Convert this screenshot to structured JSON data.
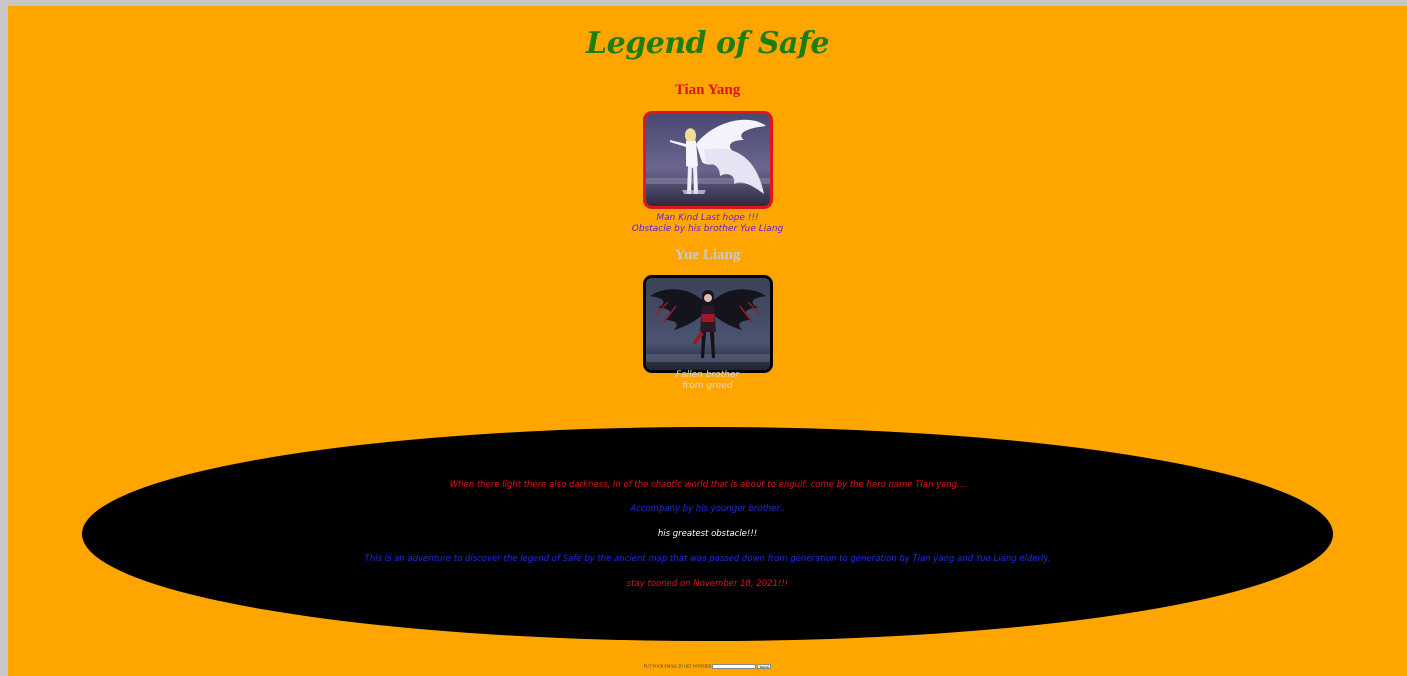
{
  "page": {
    "title": "Legend of Safe"
  },
  "heroes": [
    {
      "name": "Tian Yang",
      "name_color": "#e0141c",
      "frame_color": "#e0141c",
      "caption_lines": [
        "Man Kind Last hope !!!",
        "Obstacle by his brother Yue Liang"
      ],
      "caption_color": "#6a1fd0"
    },
    {
      "name": "Yue Liang",
      "name_color": "#c9c9c9",
      "frame_color": "#000000",
      "caption_lines": [
        "Fallen brother",
        "from greed"
      ],
      "caption_color": "#d8d8d8"
    }
  ],
  "story": {
    "lines": [
      {
        "text": "When there light there also darkness, In of the chaotic world that is about to engulf. come by the hero name Tian yang...",
        "color": "#e0141c"
      },
      {
        "text": "Accompany by his younger brother..",
        "color": "#1a2fd8"
      },
      {
        "text": "his greatest obstacle!!!",
        "color": "#ffffff"
      },
      {
        "text": "This is an adventure to discover the legend of Safe by the ancient map that was passed down from generation to generation by Tian yang and Yue Liang elderly.",
        "color": "#1a2fd8"
      },
      {
        "text": "stay tooned on November 18, 2021!!!",
        "color": "#e0141c"
      }
    ]
  },
  "signup": {
    "label": "PUT YOUR EMAIL TO GET NOTIFIED",
    "input_placeholder": "",
    "button_label": "Submit"
  },
  "colors": {
    "background": "#ffa500",
    "title": "#1e7d10",
    "story_panel": "#000000"
  }
}
